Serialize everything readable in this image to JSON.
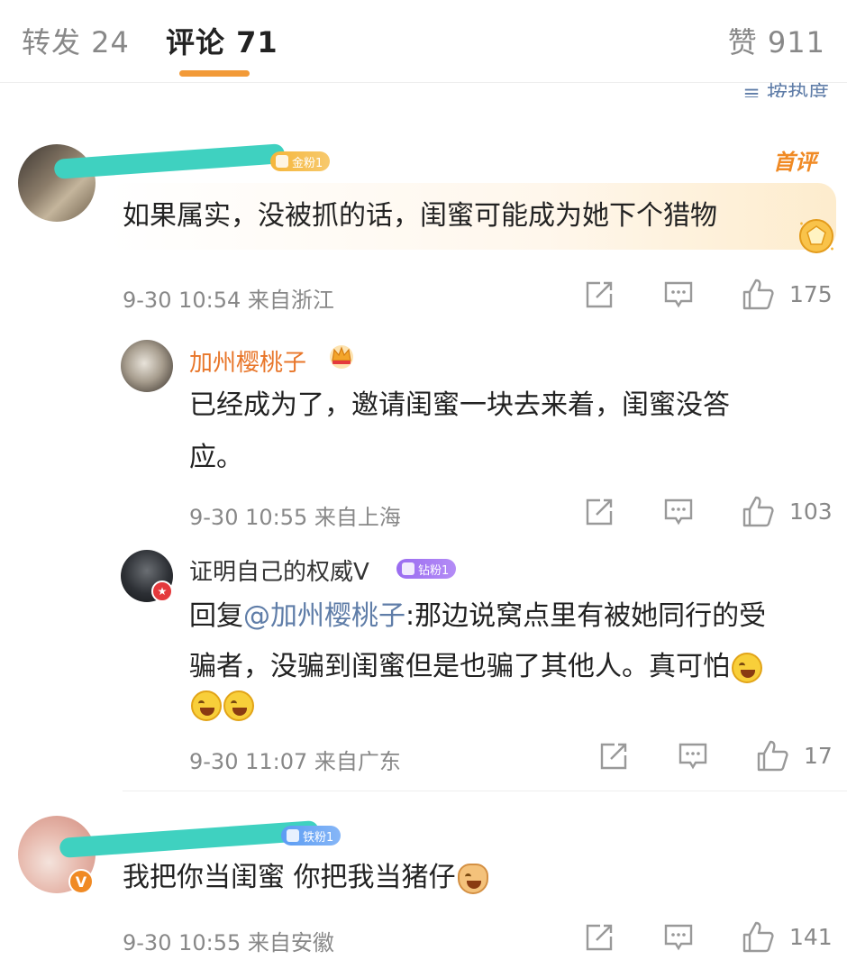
{
  "tabs": {
    "repost": "转发 24",
    "comments": "评论 71",
    "likes": "赞 911"
  },
  "sort_label": "≡ 按热度",
  "accent_color": "#f29a38",
  "comments": [
    {
      "username": "",
      "fan_badge": "金粉1",
      "first_tag": "首评",
      "text": "如果属实，没被抓的话，闺蜜可能成为她下个猎物",
      "time": "9-30 10:54",
      "location": "来自浙江",
      "likes": "175"
    },
    {
      "username": "加州樱桃子",
      "text_line1": "已经成为了，邀请闺蜜一块去来着，闺蜜没答",
      "text_line2": "应。",
      "time": "9-30 10:55",
      "location": "来自上海",
      "likes": "103"
    },
    {
      "username": "证明自己的权威V",
      "fan_badge": "钻粉1",
      "reply_prefix": "回复",
      "mention": "@加州樱桃子",
      "text_line1": ":那边说窝点里有被她同行的受",
      "text_line2": "骗者，没骗到闺蜜但是也骗了其他人。真可怕",
      "time": "9-30 11:07",
      "location": "来自广东",
      "likes": "17"
    },
    {
      "username": "",
      "fan_badge": "铁粉1",
      "text": "我把你当闺蜜 你把我当猪仔",
      "time": "9-30 10:55",
      "location": "来自安徽",
      "likes": "141"
    }
  ],
  "icons": [
    "share-icon",
    "comment-icon",
    "like-icon",
    "crown-icon",
    "gold-coin-icon",
    "laugh-cry-emoji",
    "dog-emoji"
  ]
}
